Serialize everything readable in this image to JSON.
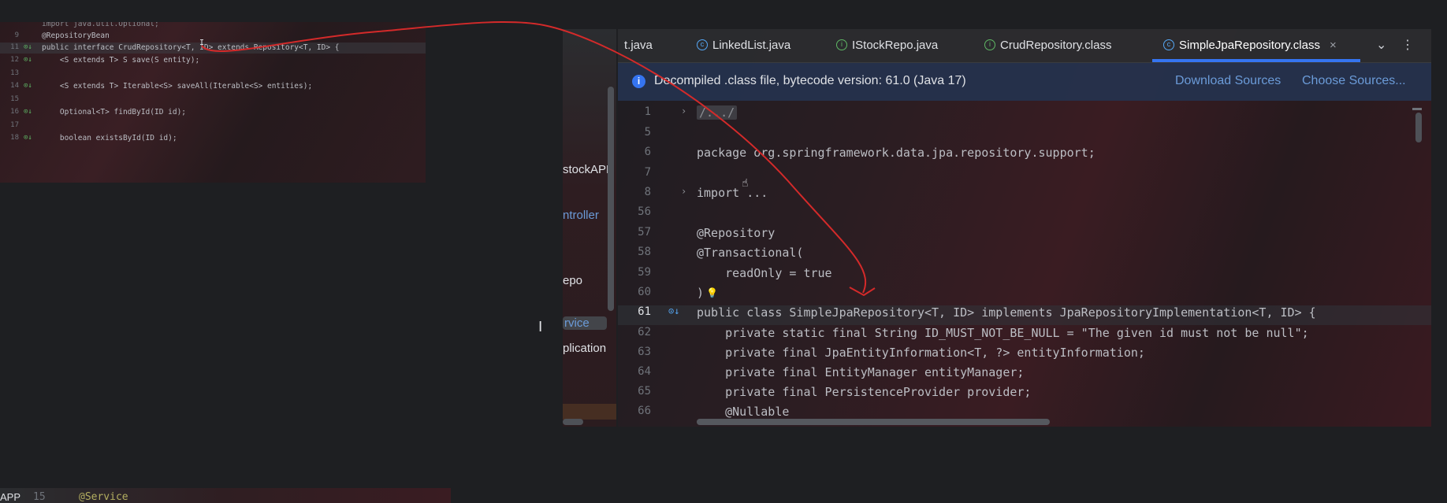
{
  "snippet": {
    "lines": [
      {
        "num": "",
        "text": "import java.util.Optional;"
      },
      {
        "num": "9",
        "text": "@RepositoryBean"
      },
      {
        "num": "11",
        "text": "public interface CrudRepository<T, ID> extends Repository<T, ID> {"
      },
      {
        "num": "12",
        "text": "    <S extends T> S save(S entity);"
      },
      {
        "num": "13",
        "text": ""
      },
      {
        "num": "14",
        "text": "    <S extends T> Iterable<S> saveAll(Iterable<S> entities);"
      },
      {
        "num": "15",
        "text": ""
      },
      {
        "num": "16",
        "text": "    Optional<T> findById(ID id);"
      },
      {
        "num": "17",
        "text": ""
      },
      {
        "num": "18",
        "text": "    boolean existsById(ID id);"
      }
    ]
  },
  "tree": {
    "items": [
      {
        "label": "stockAPP"
      },
      {
        "label": "ntroller"
      },
      {
        "label": "epo"
      },
      {
        "label": "rvice"
      },
      {
        "label": "plication"
      }
    ]
  },
  "tabs": [
    {
      "label": "t.java",
      "icon": ""
    },
    {
      "label": "LinkedList.java",
      "icon": "class-icon"
    },
    {
      "label": "IStockRepo.java",
      "icon": "interface-icon"
    },
    {
      "label": "CrudRepository.class",
      "icon": "interface-icon"
    },
    {
      "label": "SimpleJpaRepository.class",
      "icon": "class-icon",
      "close": "×"
    }
  ],
  "tab_controls": {
    "more": "⌄",
    "menu": "⋮"
  },
  "banner": {
    "message": "Decompiled .class file, bytecode version: 61.0 (Java 17)",
    "download": "Download Sources",
    "choose": "Choose Sources..."
  },
  "editor": {
    "lines": [
      {
        "num": "1",
        "text": "/.../"
      },
      {
        "num": "5",
        "text": ""
      },
      {
        "num": "6",
        "text": "package org.springframework.data.jpa.repository.support;"
      },
      {
        "num": "7",
        "text": ""
      },
      {
        "num": "8",
        "text": "import ..."
      },
      {
        "num": "56",
        "text": ""
      },
      {
        "num": "57",
        "text": "@Repository"
      },
      {
        "num": "58",
        "text": "@Transactional("
      },
      {
        "num": "59",
        "text": "    readOnly = true"
      },
      {
        "num": "60",
        "text": ")"
      },
      {
        "num": "61",
        "text": "public class SimpleJpaRepository<T, ID> implements JpaRepositoryImplementation<T, ID> {"
      },
      {
        "num": "62",
        "text": "    private static final String ID_MUST_NOT_BE_NULL = \"The given id must not be null\";"
      },
      {
        "num": "63",
        "text": "    private final JpaEntityInformation<T, ?> entityInformation;"
      },
      {
        "num": "64",
        "text": "    private final EntityManager entityManager;"
      },
      {
        "num": "65",
        "text": "    private final PersistenceProvider provider;"
      },
      {
        "num": "66",
        "text": "    @Nullable"
      }
    ]
  },
  "bottom": {
    "line_num": "15",
    "text": "@Service",
    "label": "APP"
  },
  "colors": {
    "accent": "#3574f0",
    "annotation_arrow": "#d42a2a"
  }
}
